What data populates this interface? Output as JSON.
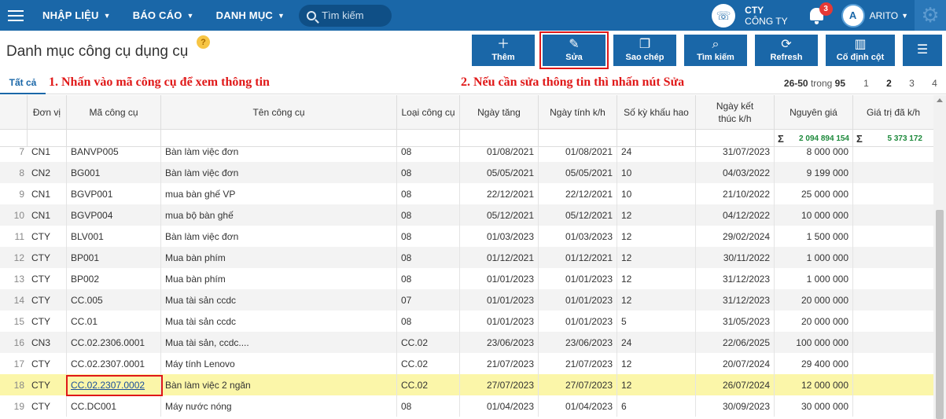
{
  "topbar": {
    "menu": [
      {
        "label": "NHẬP LIỆU"
      },
      {
        "label": "BÁO CÁO"
      },
      {
        "label": "DANH MỤC"
      }
    ],
    "search_placeholder": "Tìm kiếm",
    "company_code": "CTY",
    "company_name": "CÔNG TY",
    "notification_count": "3",
    "avatar_text": "A",
    "username": "ARITO"
  },
  "page": {
    "title": "Danh mục công cụ dụng cụ",
    "help": "?"
  },
  "toolbar": {
    "add": "Thêm",
    "edit": "Sửa",
    "copy": "Sao chép",
    "find": "Tìm kiếm",
    "refresh": "Refresh",
    "pin": "Cố định cột"
  },
  "tabs": {
    "all": "Tất cả"
  },
  "notes": {
    "note1": "1. Nhấn vào mã công cụ để xem thông tin",
    "note2": "2. Nếu cần sửa thông tin thì nhấn nút Sửa"
  },
  "pager": {
    "range": "26-50",
    "of": "trong",
    "total": "95",
    "pages": [
      "1",
      "2",
      "3",
      "4"
    ],
    "current": "2"
  },
  "columns": {
    "unit": "Đơn vị",
    "code": "Mã công cụ",
    "name": "Tên công cụ",
    "type": "Loại công cụ",
    "date_inc": "Ngày tăng",
    "date_dep": "Ngày tính k/h",
    "periods": "Số kỳ khấu hao",
    "date_end": "Ngày kết thúc k/h",
    "cost": "Nguyên giá",
    "depreciated": "Giá trị đã k/h"
  },
  "totals": {
    "sigma": "Σ",
    "cost": "2 094 894 154",
    "depreciated": "5 373 172"
  },
  "rows": [
    {
      "no": "7",
      "unit": "CN1",
      "code": "BANVP005",
      "name": "Bàn làm việc đơn",
      "type": "08",
      "date_inc": "01/08/2021",
      "date_dep": "01/08/2021",
      "periods": "24",
      "date_end": "31/07/2023",
      "cost": "8 000 000"
    },
    {
      "no": "8",
      "unit": "CN2",
      "code": "BG001",
      "name": "Bàn làm việc đơn",
      "type": "08",
      "date_inc": "05/05/2021",
      "date_dep": "05/05/2021",
      "periods": "10",
      "date_end": "04/03/2022",
      "cost": "9 199 000"
    },
    {
      "no": "9",
      "unit": "CN1",
      "code": "BGVP001",
      "name": "mua bàn ghế VP",
      "type": "08",
      "date_inc": "22/12/2021",
      "date_dep": "22/12/2021",
      "periods": "10",
      "date_end": "21/10/2022",
      "cost": "25 000 000"
    },
    {
      "no": "10",
      "unit": "CN1",
      "code": "BGVP004",
      "name": "mua bộ bàn ghế",
      "type": "08",
      "date_inc": "05/12/2021",
      "date_dep": "05/12/2021",
      "periods": "12",
      "date_end": "04/12/2022",
      "cost": "10 000 000"
    },
    {
      "no": "11",
      "unit": "CTY",
      "code": "BLV001",
      "name": "Bàn làm việc đơn",
      "type": "08",
      "date_inc": "01/03/2023",
      "date_dep": "01/03/2023",
      "periods": "12",
      "date_end": "29/02/2024",
      "cost": "1 500 000"
    },
    {
      "no": "12",
      "unit": "CTY",
      "code": "BP001",
      "name": "Mua bàn phím",
      "type": "08",
      "date_inc": "01/12/2021",
      "date_dep": "01/12/2021",
      "periods": "12",
      "date_end": "30/11/2022",
      "cost": "1 000 000"
    },
    {
      "no": "13",
      "unit": "CTY",
      "code": "BP002",
      "name": "Mua bàn phím",
      "type": "08",
      "date_inc": "01/01/2023",
      "date_dep": "01/01/2023",
      "periods": "12",
      "date_end": "31/12/2023",
      "cost": "1 000 000"
    },
    {
      "no": "14",
      "unit": "CTY",
      "code": "CC.005",
      "name": "Mua tài sản ccdc",
      "type": "07",
      "date_inc": "01/01/2023",
      "date_dep": "01/01/2023",
      "periods": "12",
      "date_end": "31/12/2023",
      "cost": "20 000 000"
    },
    {
      "no": "15",
      "unit": "CTY",
      "code": "CC.01",
      "name": "Mua tài sản ccdc",
      "type": "08",
      "date_inc": "01/01/2023",
      "date_dep": "01/01/2023",
      "periods": "5",
      "date_end": "31/05/2023",
      "cost": "20 000 000"
    },
    {
      "no": "16",
      "unit": "CN3",
      "code": "CC.02.2306.0001",
      "name": "Mua tài sản, ccdc....",
      "type": "CC.02",
      "date_inc": "23/06/2023",
      "date_dep": "23/06/2023",
      "periods": "24",
      "date_end": "22/06/2025",
      "cost": "100 000 000"
    },
    {
      "no": "17",
      "unit": "CTY",
      "code": "CC.02.2307.0001",
      "name": "Máy tính Lenovo",
      "type": "CC.02",
      "date_inc": "21/07/2023",
      "date_dep": "21/07/2023",
      "periods": "12",
      "date_end": "20/07/2024",
      "cost": "29 400 000"
    },
    {
      "no": "18",
      "unit": "CTY",
      "code": "CC.02.2307.0002",
      "name": "Bàn làm việc 2 ngăn",
      "type": "CC.02",
      "date_inc": "27/07/2023",
      "date_dep": "27/07/2023",
      "periods": "12",
      "date_end": "26/07/2024",
      "cost": "12 000 000",
      "highlight": true
    },
    {
      "no": "19",
      "unit": "CTY",
      "code": "CC.DC001",
      "name": "Máy nước nóng",
      "type": "08",
      "date_inc": "01/04/2023",
      "date_dep": "01/04/2023",
      "periods": "6",
      "date_end": "30/09/2023",
      "cost": "30 000 000"
    }
  ]
}
